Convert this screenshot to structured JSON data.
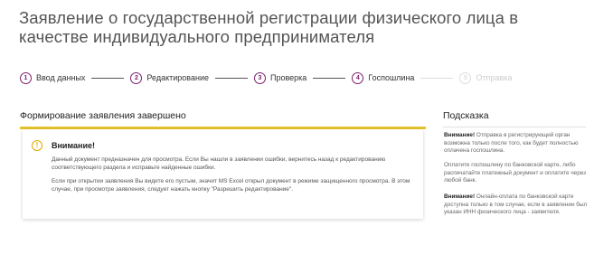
{
  "page": {
    "title": "Заявление о государственной регистрации физического лица в качестве индивидуального предпринимателя"
  },
  "steps": [
    {
      "number": "1",
      "label": "Ввод данных"
    },
    {
      "number": "2",
      "label": "Редактирование"
    },
    {
      "number": "3",
      "label": "Проверка"
    },
    {
      "number": "4",
      "label": "Госпошлина"
    },
    {
      "number": "5",
      "label": "Отправка"
    }
  ],
  "main": {
    "heading": "Формирование заявления завершено",
    "warning": {
      "icon": "exclamation-icon",
      "title": "Внимание!",
      "paragraph1": "Данный документ предназначен для просмотра. Если Вы нашли в заявлении ошибки, вернитесь назад к редактированию соответствующего раздела и исправьте найденные ошибки.",
      "paragraph2": "Если при открытии заявления Вы видите его пустым, значит MS Excel открыл документ в режиме защищенного просмотра. В этом случае, при просмотре заявления, следует нажать кнопку \"Разрешить редактирование\"."
    }
  },
  "sidebar": {
    "heading": "Подсказка",
    "hint1_bold": "Внимание!",
    "hint1_text": " Отправка в регистрирующий орган возможна только после того, как будет полностью оплачена госпошлина.",
    "hint2_text": "Оплатите госпошлину по банковской карте, либо распечатайте платежный документ и оплатите через любой банк.",
    "hint3_bold": "Внимание!",
    "hint3_text": " Онлайн-оплата по банковской карте доступна только в том случае, если в заявлении был указан ИНН физического лица - заявителя."
  },
  "colors": {
    "accent": "#7c1f6f",
    "warning": "#e6c52a"
  }
}
